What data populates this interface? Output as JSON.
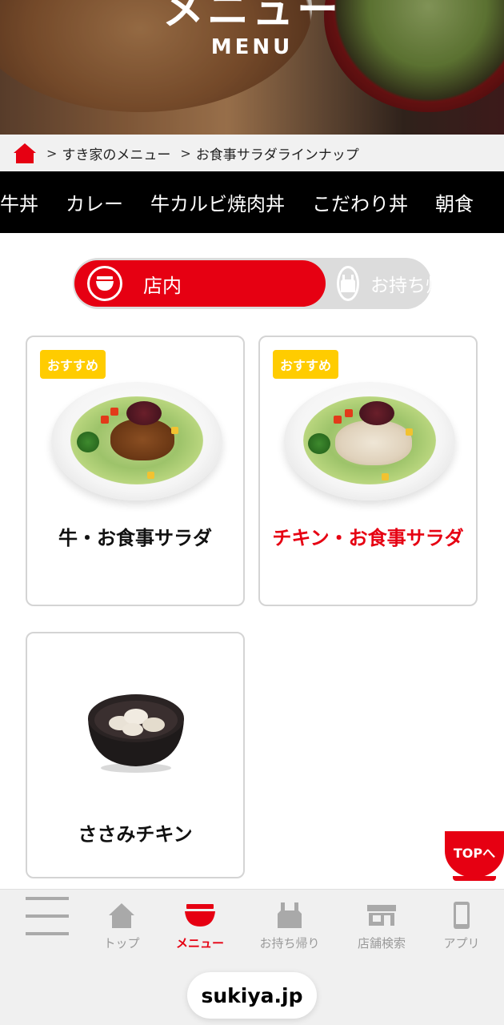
{
  "hero": {
    "title": "メニュー",
    "subtitle": "MENU"
  },
  "breadcrumb": {
    "home_icon": "home-icon",
    "items": [
      "すき家のメニュー",
      "お食事サラダラインナップ"
    ]
  },
  "categories": [
    "牛丼",
    "カレー",
    "牛カルビ焼肉丼",
    "こだわり丼",
    "朝食"
  ],
  "toggle": {
    "options": [
      {
        "label": "店内",
        "icon": "bowl-icon",
        "active": true
      },
      {
        "label": "お持ち帰り",
        "icon": "bag-icon",
        "active": false
      }
    ],
    "active_color": "#e60012"
  },
  "products": [
    {
      "name": "牛・お食事サラダ",
      "badge": "おすすめ",
      "highlight": false
    },
    {
      "name": "チキン・お食事サラダ",
      "badge": "おすすめ",
      "highlight": true
    },
    {
      "name": "ささみチキン",
      "badge": "",
      "highlight": false
    }
  ],
  "top_button": "TOPへ",
  "tabbar": [
    {
      "label": "",
      "icon": "hamburger-menu-icon"
    },
    {
      "label": "トップ",
      "icon": "home-icon"
    },
    {
      "label": "メニュー",
      "icon": "bowl-icon",
      "active": true
    },
    {
      "label": "お持ち帰り",
      "icon": "bag-icon"
    },
    {
      "label": "店舗検索",
      "icon": "store-icon"
    },
    {
      "label": "アプリ",
      "icon": "phone-icon"
    }
  ],
  "browser": {
    "url": "sukiya.jp"
  },
  "colors": {
    "brand_red": "#e60012",
    "badge_yellow": "#ffcc00",
    "nav_black": "#000000"
  }
}
